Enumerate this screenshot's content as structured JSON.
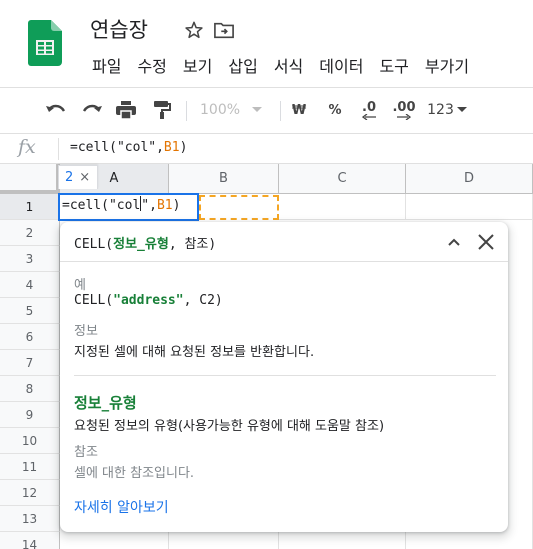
{
  "document": {
    "title": "연습장",
    "star_icon": "star-outline-icon",
    "move_icon": "move-to-folder-icon"
  },
  "menu": {
    "items": [
      "파일",
      "수정",
      "보기",
      "삽입",
      "서식",
      "데이터",
      "도구",
      "부가기"
    ]
  },
  "toolbar": {
    "zoom_value": "100%",
    "currency_label": "₩",
    "percent_label": "%",
    "decrease_decimal_label": ".0",
    "increase_decimal_label": ".00",
    "number_format_label": "123"
  },
  "formula_bar": {
    "fx_label": "fx",
    "formula_prefix": "=cell(\"col\",",
    "formula_ref": "B1",
    "formula_suffix": ")"
  },
  "grid": {
    "columns": [
      "A",
      "B",
      "C",
      "D"
    ],
    "rows": [
      "1",
      "2",
      "3",
      "4",
      "5",
      "6",
      "7",
      "8",
      "9",
      "10",
      "11",
      "12",
      "13",
      "14"
    ],
    "active_cell": {
      "text_before_caret": "=cell(\"col",
      "text_after_caret": "\",",
      "ref": "B1",
      "close_paren": ")"
    },
    "chip": {
      "count": "2",
      "close": "×"
    }
  },
  "help_popup": {
    "signature_fn": "CELL(",
    "signature_param1": "정보_유형",
    "signature_rest": ", 참조)",
    "example_label": "예",
    "example_fn": "CELL(",
    "example_arg": "\"address\"",
    "example_rest": ", C2)",
    "info_label": "정보",
    "info_text": "지정된 셀에 대해 요청된 정보를 반환합니다.",
    "param1_name": "정보_유형",
    "param1_desc": "요청된 정보의 유형(사용가능한 유형에 대해 도움말 참조)",
    "param2_name": "참조",
    "param2_desc": "셀에 대한 참조입니다.",
    "learn_more": "자세히 알아보기"
  },
  "colors": {
    "accent": "#1a73e8",
    "function_green": "#188038",
    "reference_orange": "#f5a623"
  }
}
